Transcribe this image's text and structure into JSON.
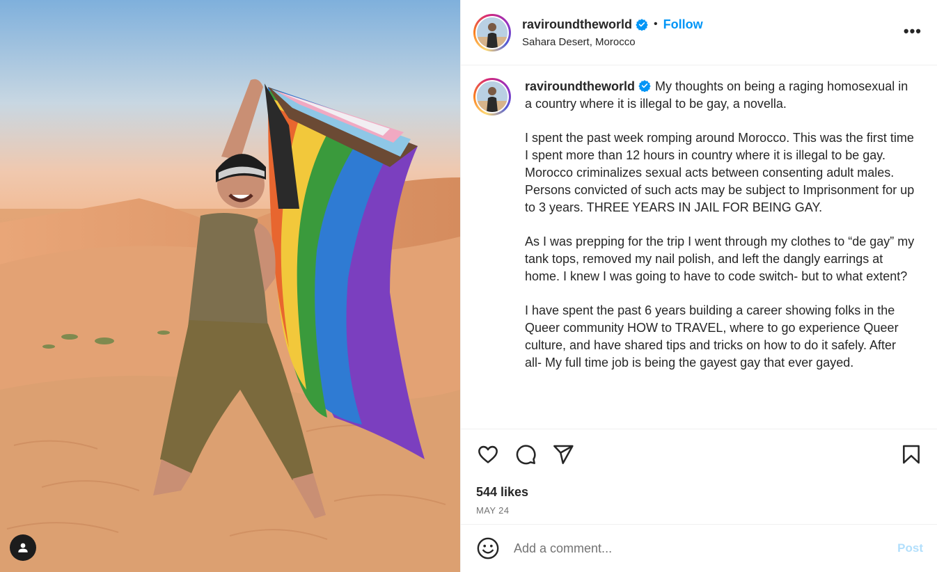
{
  "post": {
    "username": "raviroundtheworld",
    "follow_label": "Follow",
    "separator": "•",
    "location": "Sahara Desert, Morocco",
    "more_label": "•••"
  },
  "caption": {
    "username": "raviroundtheworld",
    "paragraphs": [
      "My thoughts on being a raging homosexual in a country where it is illegal to be gay, a novella.",
      "I spent the past week romping around Morocco. This was the first time I spent more than 12 hours in country where it is illegal to be gay. Morocco criminalizes sexual acts between consenting adult males.",
      "Persons convicted of such acts may be subject to Imprisonment for up to 3 years. THREE YEARS IN JAIL FOR BEING GAY.",
      "As I was prepping for the trip I went through my clothes to “de gay” my tank tops, removed my nail polish, and left the dangly earrings at home. I knew I was going to have to code switch- but to what extent?",
      "I have spent the past 6 years building a career showing folks in the Queer community HOW to TRAVEL, where to go experience Queer culture, and have shared tips and tricks on how to do it safely. After all- My full time job is being the gayest gay that ever gayed."
    ]
  },
  "engagement": {
    "likes": "544 likes",
    "date": "MAY 24"
  },
  "comment": {
    "placeholder": "Add a comment...",
    "post_label": "Post"
  },
  "icons": {
    "like": "heart-icon",
    "comment": "comment-icon",
    "share": "share-icon",
    "save": "bookmark-icon",
    "emoji": "emoji-icon",
    "tagged_user": "user-icon",
    "verified": "verified-badge-icon"
  },
  "colors": {
    "link_blue": "#0095f6",
    "verified_blue": "#0095f6",
    "post_disabled": "#b2dffc",
    "muted": "#737373"
  }
}
